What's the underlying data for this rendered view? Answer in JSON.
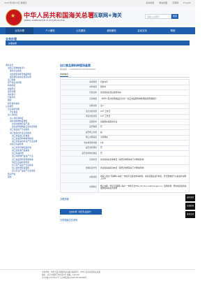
{
  "topbar": {
    "date": "2021年6月24日 星期四",
    "links": [
      "海关信箱",
      "网站地图",
      "无障碍",
      "English"
    ]
  },
  "header": {
    "cn_title": "中华人民共和国海关总署",
    "en_title": "GENERAL ADMINISTRATION OF CUSTOMS P.R.CHINA",
    "site_name": "互联网+海关",
    "search_placeholder": "请输入关键字",
    "search_button": "搜索"
  },
  "nav": {
    "items": [
      "业务办理",
      "个人服务",
      "公共服务",
      "我的服务",
      "互动交流",
      "帮助"
    ]
  },
  "section": {
    "title": "业务办理",
    "bar_label": "办事指南"
  },
  "sidebar": {
    "items": [
      {
        "label": "通关业务",
        "level": 0
      },
      {
        "label": "进出口货物收发货人",
        "level": 1
      },
      {
        "label": "报关企业备案",
        "level": 2
      },
      {
        "label": "进出境旅客携带物品申报",
        "level": 2
      },
      {
        "label": "报关单位备案变更及注销",
        "level": 2
      },
      {
        "label": "出口退税",
        "level": 1
      },
      {
        "label": "原产地证书管理",
        "level": 1
      },
      {
        "label": "检验检疫",
        "level": 1
      },
      {
        "label": "船舶登记",
        "level": 1
      },
      {
        "label": "船员管理",
        "level": 1
      },
      {
        "label": "海关统计",
        "level": 1
      },
      {
        "label": "行政许可",
        "level": 1
      },
      {
        "label": "稽查",
        "level": 1
      },
      {
        "label": "政务服务事项",
        "level": 1
      },
      {
        "label": "公共服务",
        "level": 0
      },
      {
        "label": "企业资质管理",
        "level": 1
      },
      {
        "label": "企业备案",
        "level": 2
      },
      {
        "label": "出入境检疫",
        "level": 1
      },
      {
        "label": "出入境检验检疫",
        "level": 2
      },
      {
        "label": "进境动植物检疫审批",
        "level": 2
      },
      {
        "label": "出境动植物及其产品",
        "level": 3
      },
      {
        "label": "进出境特殊物品卫生检疫审批",
        "level": 3
      },
      {
        "label": "出口食品生产企业备案",
        "level": 2
      },
      {
        "label": "进口食品境外出口商备案",
        "level": 2
      },
      {
        "label": "进口食品进口商备案",
        "level": 3
      },
      {
        "label": "出口食品原料种植场备案",
        "level": 3
      },
      {
        "label": "进口化妆品境外生产企业注册",
        "level": 3
      },
      {
        "label": "进出口商品检验",
        "level": 2
      },
      {
        "label": "出口危险货物包装检验",
        "level": 3
      },
      {
        "label": "进口旧机电产品备案",
        "level": 3
      },
      {
        "label": "出口商品检验",
        "level": 3
      },
      {
        "label": "出口动植物产品生产企业",
        "level": 3
      },
      {
        "label": "出口食品原料养殖场备案",
        "level": 3
      },
      {
        "label": "进出口商品检验鉴定",
        "level": 3
      },
      {
        "label": "出口农产品生产企业备案",
        "level": 3
      },
      {
        "label": "出入境检验检疫报检",
        "level": 3
      },
      {
        "label": "出口农业产品生产企业备案",
        "level": 3
      },
      {
        "label": "知识产权",
        "level": 1
      },
      {
        "label": "其他",
        "level": 1
      }
    ]
  },
  "main": {
    "title": "出口食品原料种植场备案",
    "subtitle": "事项编码：11000000000000000000000",
    "tab": "基本信息",
    "rows": [
      {
        "k": "事项类型",
        "v": "行政许可",
        "tall": false
      },
      {
        "k": "办件类型",
        "v": "即办件",
        "tall": false
      },
      {
        "k": "实施主体",
        "v": "各直属海关及其隶属海关",
        "tall": false
      },
      {
        "k": "实施依据",
        "v": "《中华人民共和国食品安全法》《出口食品原料种植场备案管理规定》",
        "tall": true
      },
      {
        "k": "办理对象",
        "v": "法人",
        "tall": false
      },
      {
        "k": "法定办结时限",
        "v": "20个工作日",
        "tall": false
      },
      {
        "k": "承诺办结时限",
        "v": "10个工作日",
        "tall": false
      },
      {
        "k": "受理条件",
        "v": "具备相关资质的企业",
        "tall": false
      },
      {
        "k": "是否收费",
        "v": "否",
        "tall": false
      },
      {
        "k": "是否网上办理",
        "v": "是",
        "tall": false
      },
      {
        "k": "网上办理深度",
        "v": "全程网办",
        "tall": false
      },
      {
        "k": "到办事现场次数",
        "v": "0次",
        "tall": false
      },
      {
        "k": "是否支持预约",
        "v": "否",
        "tall": false
      },
      {
        "k": "是否支持物流快递",
        "v": "否",
        "tall": false
      },
      {
        "k": "咨询方式",
        "v": "各直属海关咨询电话（请登录中国海关门户网站查询）",
        "tall": true
      },
      {
        "k": "监督投诉方式",
        "v": "各直属海关投诉电话（请登录中国海关门户网站查询）",
        "tall": true
      },
      {
        "k": "办理流程",
        "v": "申请人通过\"互联网+海关\"一体化平台提交申请材料，海关受理后进行审核，符合要求的予以备案并在网上公布",
        "tall2": true
      },
      {
        "k": "办理地点",
        "v": "网上办理：登录\"互联网+海关\"一体化平台http://online.customs.gov.cn；现场办理：所在地直属海关或隶属海关业务现场",
        "tall2": true
      }
    ],
    "section2": "办理流程",
    "apply_button": "在线办理（需登录后操作）",
    "section3": "办事指南文件资料"
  },
  "footer": {
    "lines": [
      "主办单位：中华人民共和国海关总署  版权所有：中华人民共和国海关总署",
      "地址：北京市建国门内大街6号  邮编：100730",
      "京ICP备17015317号  京公网安备11040102700068号"
    ]
  },
  "float_tools": [
    "返回顶部",
    "在线咨询",
    "意见反馈"
  ]
}
